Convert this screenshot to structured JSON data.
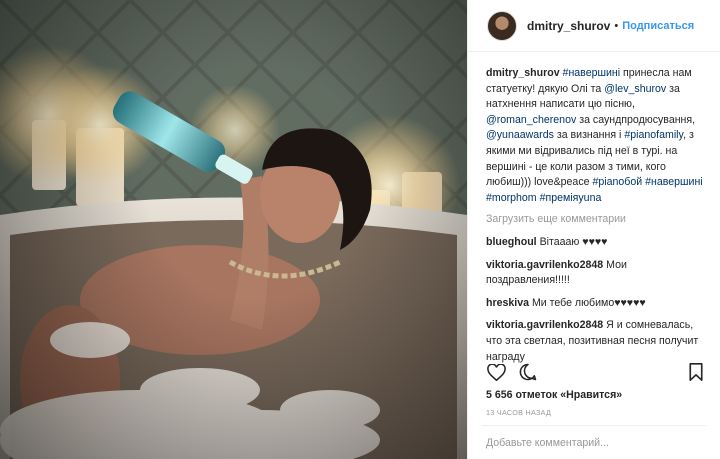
{
  "post": {
    "username": "dmitry_shurov",
    "separator": "•",
    "follow_label": "Подписаться"
  },
  "caption": {
    "username": "dmitry_shurov",
    "parts": [
      {
        "text": "#навершині",
        "link": true
      },
      {
        "text": " принесла нам статуетку! дякую Олі та ",
        "link": false
      },
      {
        "text": "@lev_shurov",
        "link": true
      },
      {
        "text": " за натхнення написати цю пісню, ",
        "link": false
      },
      {
        "text": "@roman_cherenov",
        "link": true
      },
      {
        "text": " за саундпродюсування, ",
        "link": false
      },
      {
        "text": "@yunaawards",
        "link": true
      },
      {
        "text": " за визнання і ",
        "link": false
      },
      {
        "text": "#pianofamily",
        "link": true
      },
      {
        "text": ", з якими ми відривались під неї в турі. на вершині - це коли разом з тими, кого любиш))) love&peace ",
        "link": false
      },
      {
        "text": "#pianoбой",
        "link": true
      },
      {
        "text": " ",
        "link": false
      },
      {
        "text": "#навершині",
        "link": true
      },
      {
        "text": " ",
        "link": false
      },
      {
        "text": "#morphom",
        "link": true
      },
      {
        "text": " ",
        "link": false
      },
      {
        "text": "#преміяyuna",
        "link": true
      }
    ]
  },
  "load_more": "Загрузить еще комментарии",
  "comments": [
    {
      "username": "blueghoul",
      "text": "Вітаааю ♥♥♥♥"
    },
    {
      "username": "viktoria.gavrilenko2848",
      "text": "Мои поздравления!!!!!"
    },
    {
      "username": "hreskiva",
      "text": "Ми тебе любимо♥♥♥♥♥"
    },
    {
      "username": "viktoria.gavrilenko2848",
      "text": "Я и сомневалась, что эта светлая, позитивная песня получит награду"
    }
  ],
  "likes": {
    "count_text": "5 656 отметок «Нравится»"
  },
  "timestamp": "13 ЧАСОВ НАЗАД",
  "add_comment_placeholder": "Добавьте комментарий...",
  "icons": {
    "like": "heart-icon",
    "comment": "comment-bubble-icon",
    "save": "bookmark-icon"
  },
  "colors": {
    "link": "#003569",
    "follow": "#3897f0",
    "muted": "#999999",
    "text": "#262626"
  }
}
